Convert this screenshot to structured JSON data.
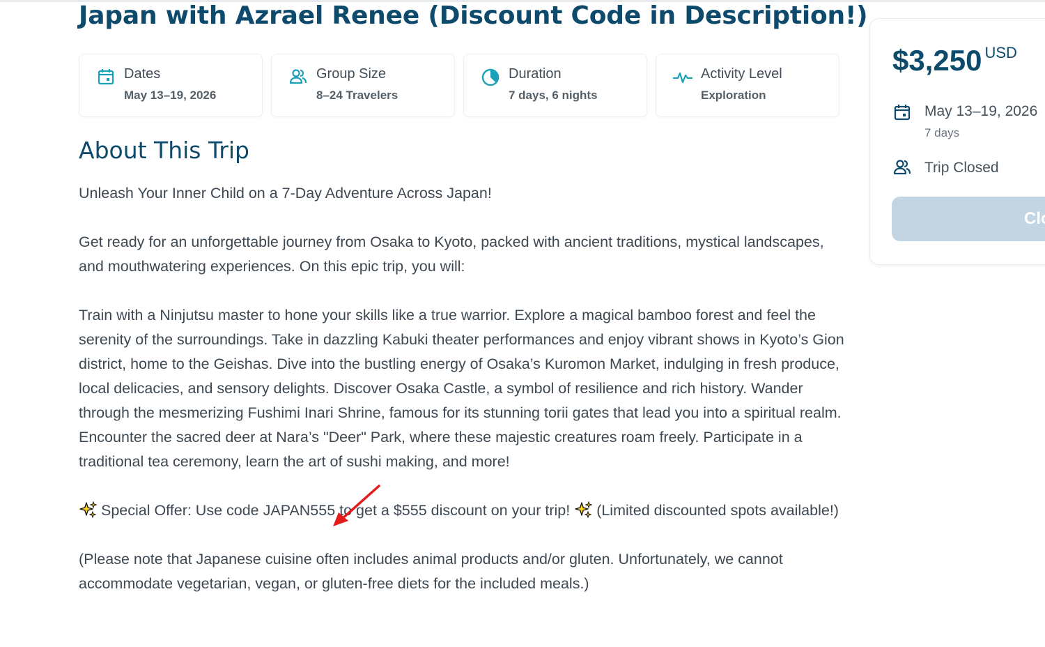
{
  "trip": {
    "title": "Japan with Azrael Renee (Discount Code in Description!)"
  },
  "info_cards": [
    {
      "icon": "calendar-icon",
      "label": "Dates",
      "value": "May 13–19, 2026"
    },
    {
      "icon": "group-icon",
      "label": "Group Size",
      "value": "8–24 Travelers"
    },
    {
      "icon": "clock-pie-icon",
      "label": "Duration",
      "value": "7 days, 6 nights"
    },
    {
      "icon": "activity-icon",
      "label": "Activity Level",
      "value": "Exploration"
    }
  ],
  "about": {
    "heading": "About This Trip",
    "intro": "Unleash Your Inner Child on a 7-Day Adventure Across Japan!",
    "para1": "Get ready for an unforgettable journey from Osaka to Kyoto, packed with ancient traditions, mystical landscapes, and mouthwatering experiences. On this epic trip, you will:",
    "para2": "Train with a Ninjutsu master to hone your skills like a true warrior. Explore a magical bamboo forest and feel the serenity of the surroundings. Take in dazzling Kabuki theater performances and enjoy vibrant shows in Kyoto’s Gion district, home to the Geishas. Dive into the bustling energy of Osaka’s Kuromon Market, indulging in fresh produce, local delicacies, and sensory delights. Discover Osaka Castle, a symbol of resilience and rich history. Wander through the mesmerizing Fushimi Inari Shrine, famous for its stunning torii gates that lead you into a spiritual realm. Encounter the sacred deer at Nara’s \"Deer\" Park, where these majestic creatures roam freely. Participate in a traditional tea ceremony, learn the art of sushi making, and more!",
    "offer_main": " Special Offer: Use code JAPAN555 to get a $555 discount on your trip! ",
    "offer_tail": " (Limited discounted spots available!)",
    "note": "(Please note that Japanese cuisine often includes animal products and/or gluten. Unfortunately, we cannot accommodate vegetarian, vegan, or gluten-free diets for the included meals.)"
  },
  "sidebar": {
    "price": "$3,250",
    "currency": "USD",
    "dates": "May 13–19, 2026",
    "days": "7 days",
    "status": "Trip Closed",
    "button_label": "Closed"
  },
  "colors": {
    "brand": "#0d4a6b",
    "icon_accent": "#1aa0b8",
    "button_disabled": "#c3d5e2",
    "annotation_arrow": "#e31b1b"
  }
}
